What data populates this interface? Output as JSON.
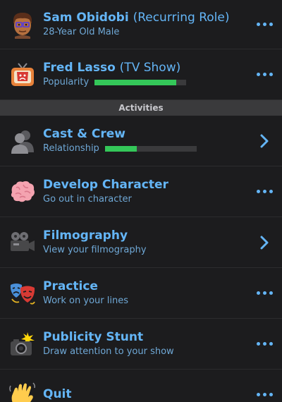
{
  "header_rows": [
    {
      "icon": "avatar-face",
      "title": "Sam Obidobi",
      "title_paren": "(Recurring Role)",
      "subtitle": "28-Year Old Male"
    },
    {
      "icon": "tv-show-icon",
      "title": "Fred Lasso",
      "title_paren": "(TV Show)",
      "subtitle": "Popularity",
      "bar_fill_fraction": 0.89
    }
  ],
  "section": {
    "label": "Activities"
  },
  "activities": [
    {
      "icon": "cast-crew-icon",
      "title": "Cast & Crew",
      "subtitle": "Relationship",
      "bar_fill_fraction": 0.35,
      "action": "chevron"
    },
    {
      "icon": "brain-icon",
      "title": "Develop Character",
      "subtitle": "Go out in character",
      "action": "more"
    },
    {
      "icon": "movie-camera-icon",
      "title": "Filmography",
      "subtitle": "View your filmography",
      "action": "chevron"
    },
    {
      "icon": "theater-masks-icon",
      "title": "Practice",
      "subtitle": "Work on your lines",
      "action": "more"
    },
    {
      "icon": "camera-flash-icon",
      "title": "Publicity Stunt",
      "subtitle": "Draw attention to your show",
      "action": "more"
    },
    {
      "icon": "waving-hand-icon",
      "title": "Quit",
      "subtitle": "",
      "action": "more"
    }
  ],
  "colors": {
    "background": "#1c1c1e",
    "accent": "#64b5f6",
    "progress": "#34c759",
    "section_bg": "#3a3a3c"
  }
}
